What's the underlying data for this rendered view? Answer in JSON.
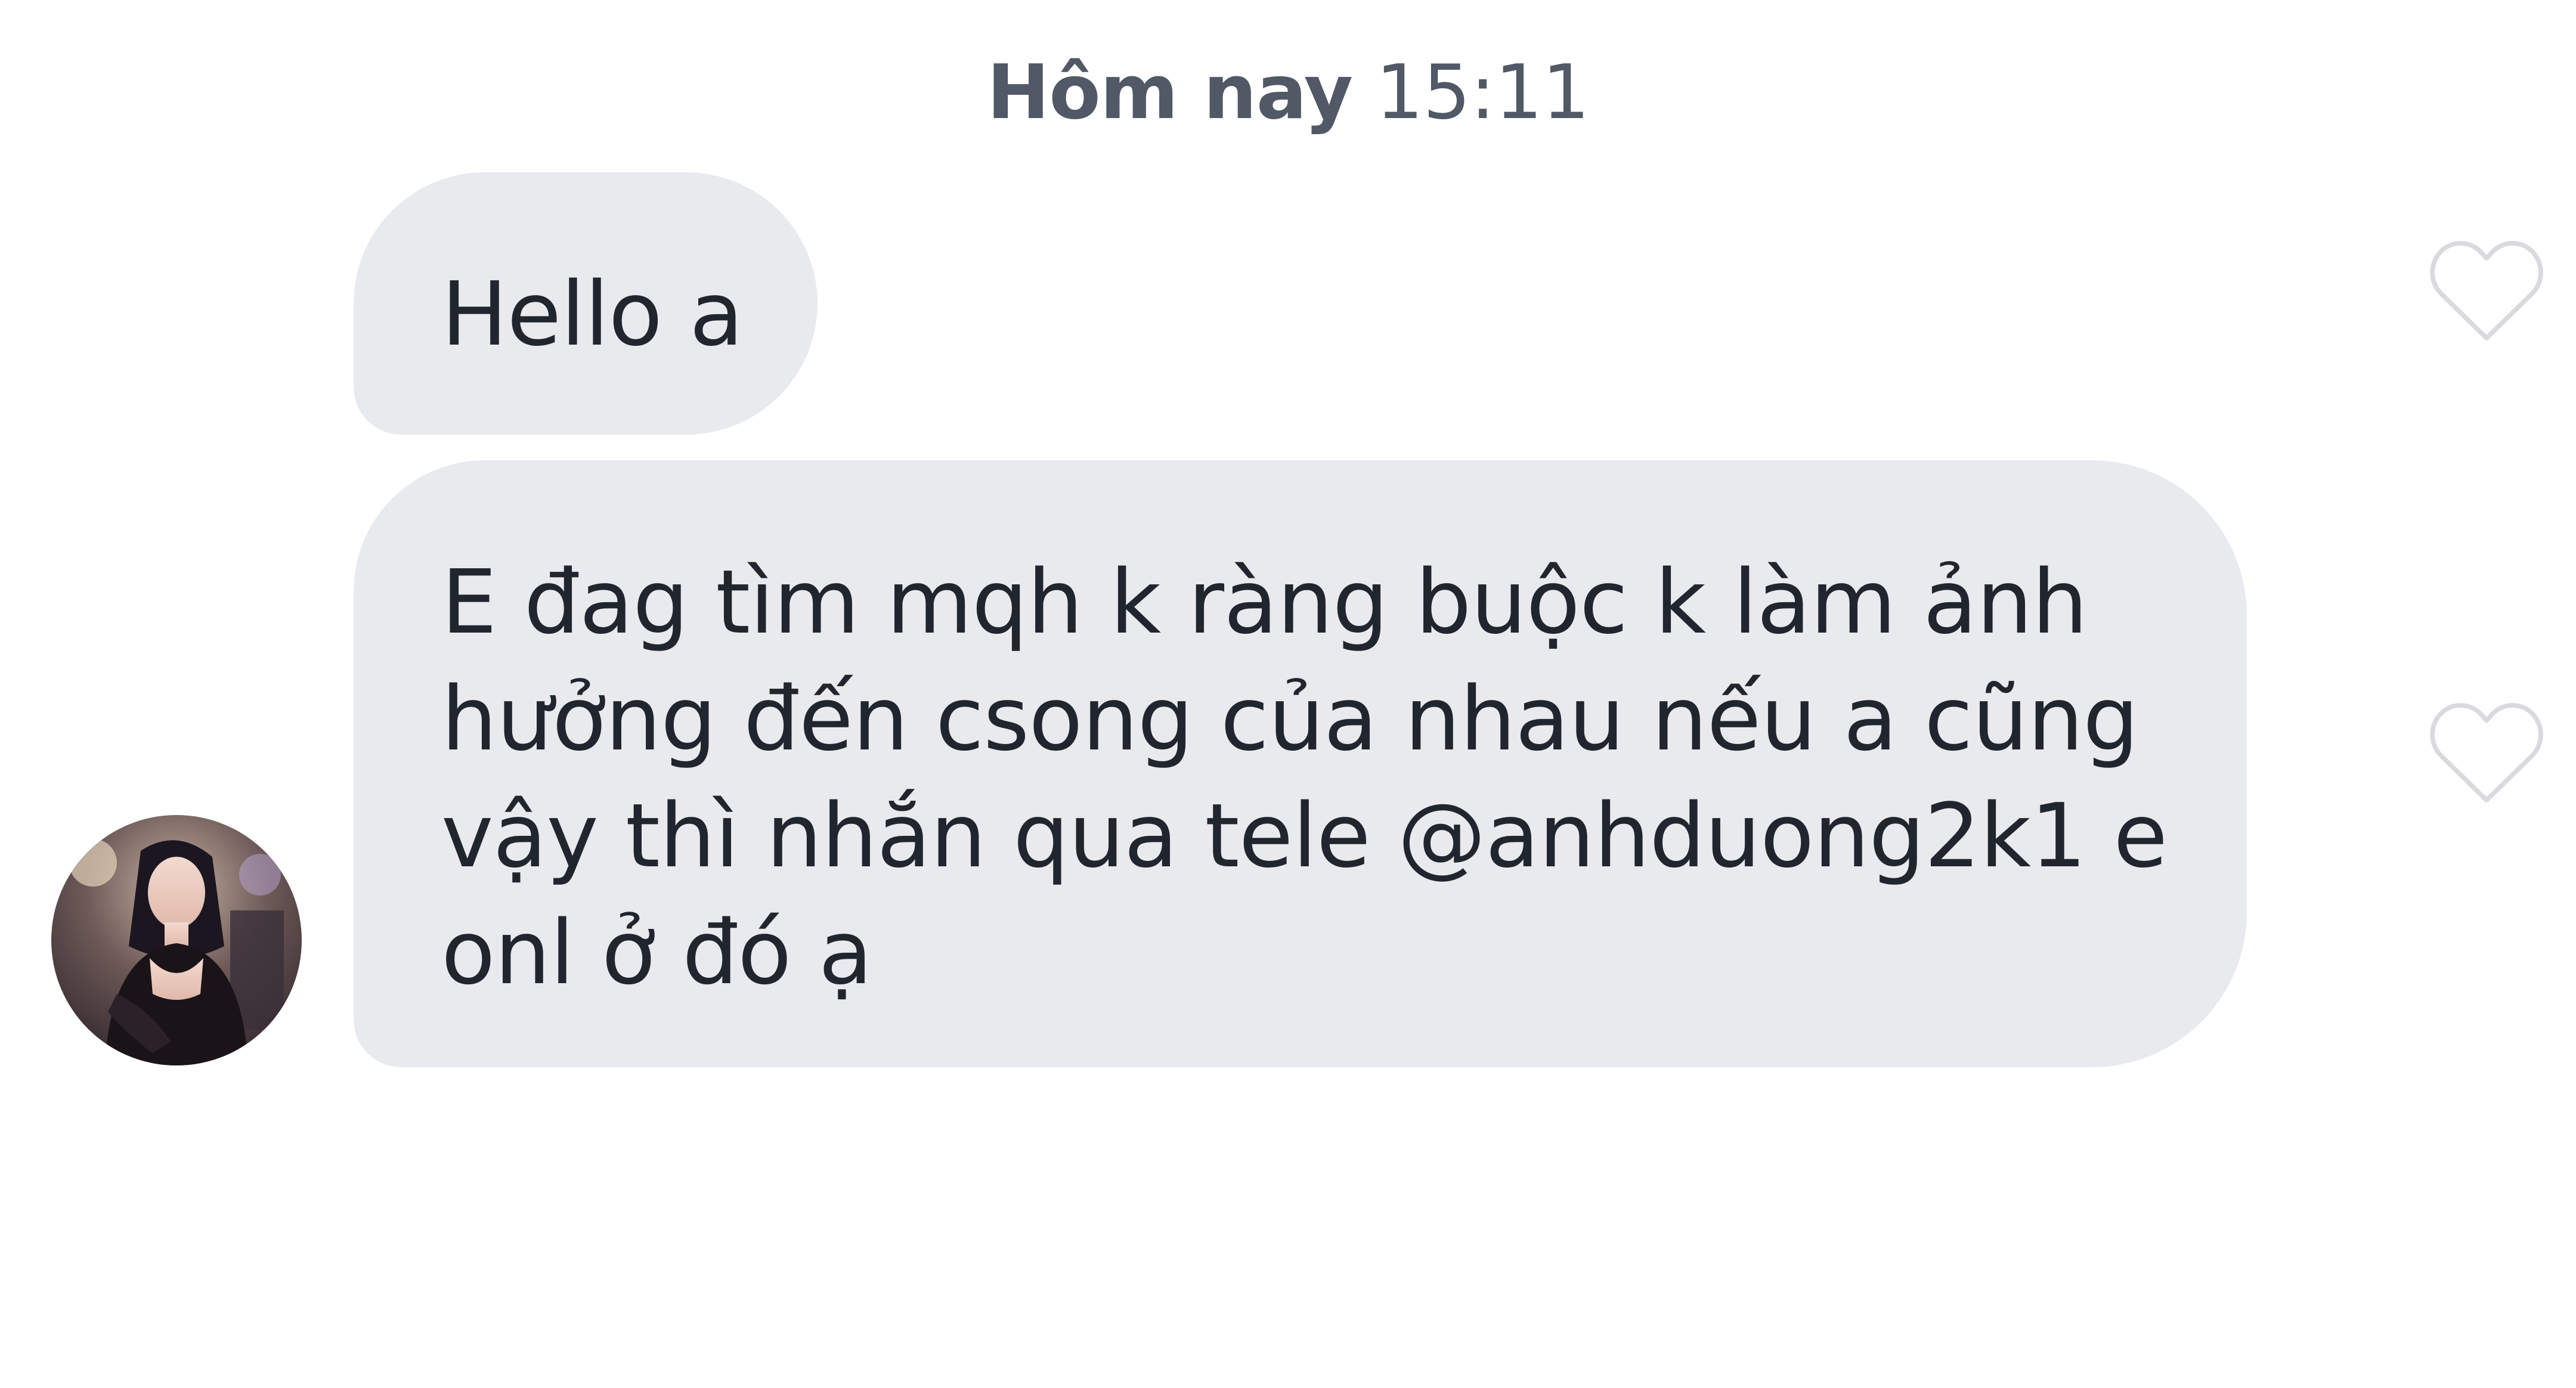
{
  "chat": {
    "timestamp": {
      "day": "Hôm nay",
      "time": "15:11"
    },
    "messages": [
      {
        "text": "Hello a",
        "liked": false
      },
      {
        "text": "E đag tìm mqh k ràng buộc k làm ảnh hưởng đến csong của nhau nếu a cũng vậy thì nhắn qua tele @anhduong2k1 e onl ở đó ạ",
        "liked": false
      }
    ],
    "icons": {
      "like": "heart-outline-icon"
    }
  },
  "colors": {
    "bubble": "#e9eaee",
    "text": "#21262e",
    "timestamp": "#505965",
    "heart_stroke": "#d9dade"
  }
}
